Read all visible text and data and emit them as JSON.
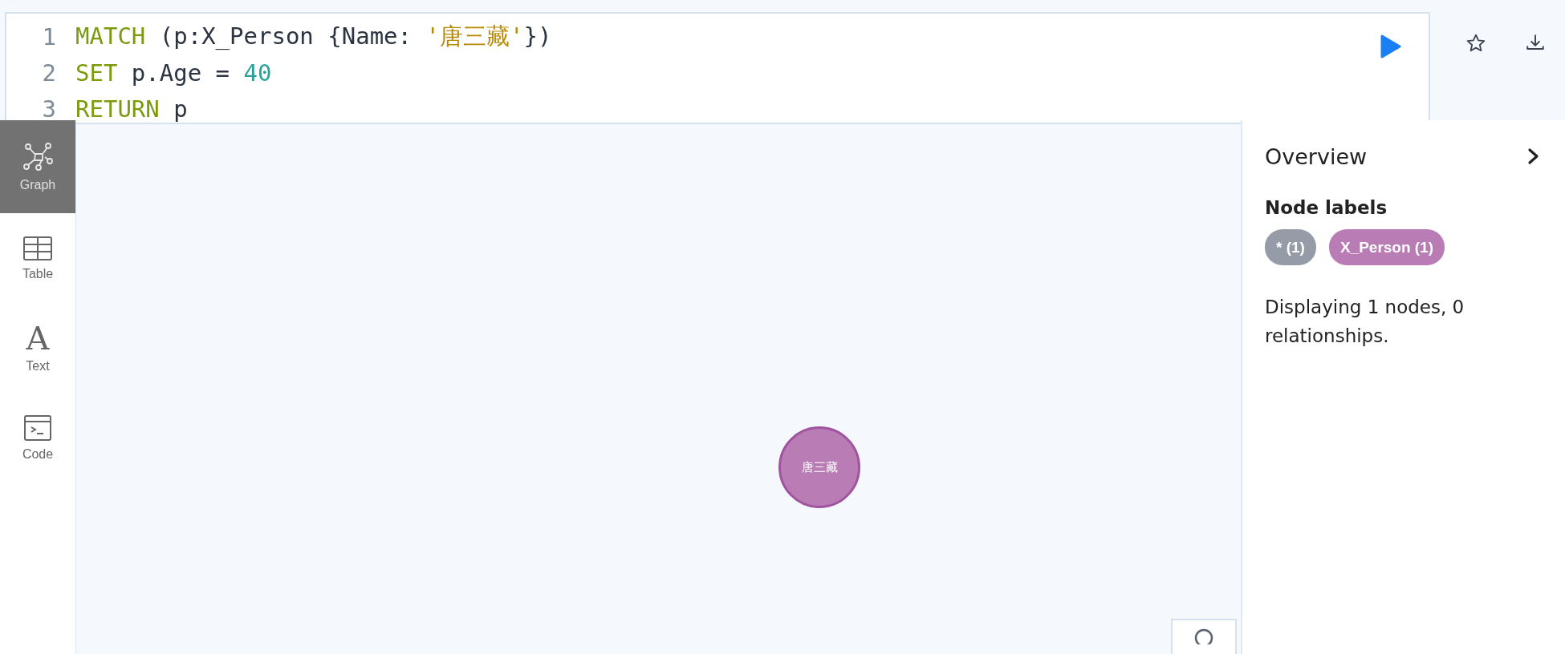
{
  "editor": {
    "lines": [
      {
        "number": "1",
        "tokens": [
          {
            "text": "MATCH",
            "kind": "keyword"
          },
          {
            "text": " (p:X_Person {Name: ",
            "kind": "plain"
          },
          {
            "text": "'唐三藏'",
            "kind": "string"
          },
          {
            "text": "})",
            "kind": "plain"
          }
        ]
      },
      {
        "number": "2",
        "tokens": [
          {
            "text": "SET",
            "kind": "keyword"
          },
          {
            "text": " p.Age = ",
            "kind": "plain"
          },
          {
            "text": "40",
            "kind": "number"
          }
        ]
      },
      {
        "number": "3",
        "tokens": [
          {
            "text": "RETURN",
            "kind": "keyword"
          },
          {
            "text": " p",
            "kind": "plain"
          }
        ]
      }
    ]
  },
  "sidebar": {
    "items": [
      {
        "label": "Graph",
        "kind": "graph",
        "selected": true
      },
      {
        "label": "Table",
        "kind": "table",
        "selected": false
      },
      {
        "label": "Text",
        "kind": "text",
        "glyph": "A",
        "selected": false
      },
      {
        "label": "Code",
        "kind": "code",
        "selected": false
      }
    ]
  },
  "graph": {
    "nodes": [
      {
        "label": "唐三藏",
        "color": "#b97cb5"
      }
    ]
  },
  "overview": {
    "title": "Overview",
    "section_title": "Node labels",
    "labels": [
      {
        "text": "* (1)",
        "color": "#959ca7"
      },
      {
        "text": "X_Person (1)",
        "color": "#b97cb5"
      }
    ],
    "summary": "Displaying 1 nodes, 0 relationships."
  }
}
